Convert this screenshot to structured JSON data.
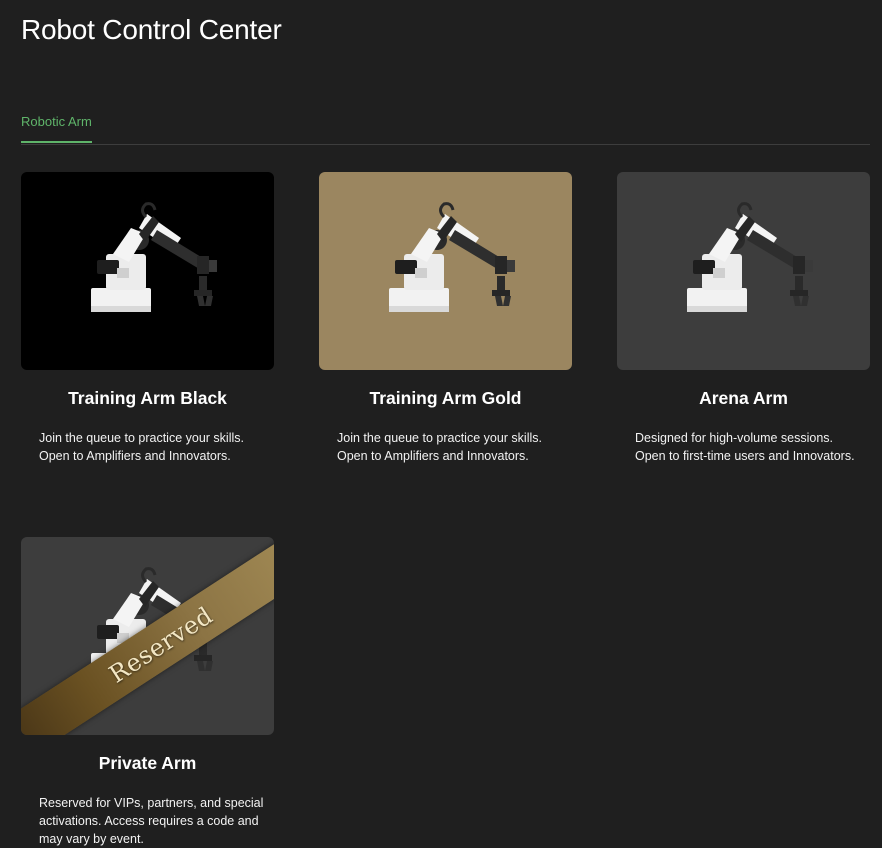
{
  "header": {
    "title": "Robot Control Center"
  },
  "tabs": [
    {
      "label": "Robotic Arm",
      "active": true
    }
  ],
  "colors": {
    "accent": "#5fb46a",
    "background": "#1f1f1f"
  },
  "cards": [
    {
      "title": "Training Arm Black",
      "description": "Join the queue to practice your skills. Open to Amplifiers and Innovators.",
      "image_background": "#000000",
      "icon": "robot-arm-icon"
    },
    {
      "title": "Training Arm Gold",
      "description": "Join the queue to practice your skills. Open to Amplifiers and Innovators.",
      "image_background": "#9b8660",
      "icon": "robot-arm-icon"
    },
    {
      "title": "Arena Arm",
      "description": "Designed for high-volume sessions. Open to first-time users and Innovators.",
      "image_background": "#3d3d3d",
      "icon": "robot-arm-icon"
    },
    {
      "title": "Private Arm",
      "description": "Reserved for VIPs, partners, and special activations. Access requires a code and may vary by event.",
      "image_background": "#3d3d3d",
      "icon": "robot-arm-icon",
      "banner": "Reserved"
    }
  ]
}
